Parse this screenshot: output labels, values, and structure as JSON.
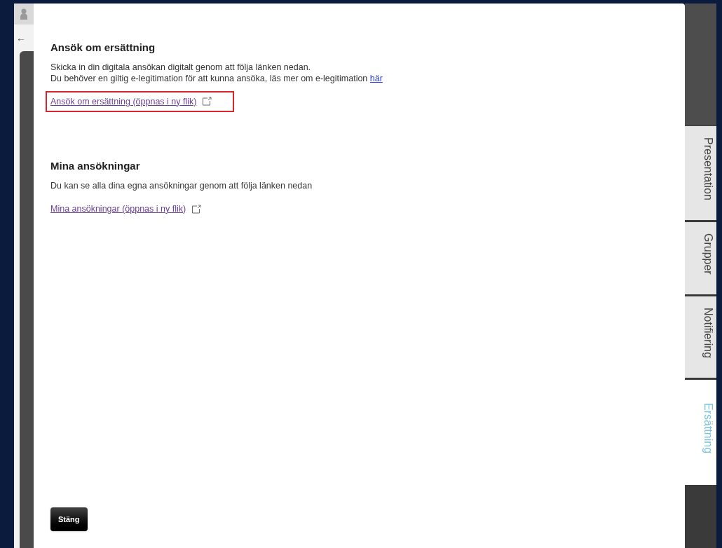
{
  "sidebar": {
    "back_arrow": "←"
  },
  "sections": [
    {
      "title": "Ansök om ersättning",
      "lines": [
        "Skicka in din digitala ansökan digitalt genom att följa länken nedan.",
        "Du behöver en giltig e-legitimation för att kunna ansöka, läs mer om e-legitimation"
      ],
      "inline_link": "här",
      "link": {
        "label": "Ansök om ersättning (öppnas i ny flik)",
        "highlighted": true
      }
    },
    {
      "title": "Mina ansökningar",
      "lines": [
        "Du kan se alla dina egna ansökningar genom att följa länken nedan"
      ],
      "link": {
        "label": "Mina ansökningar (öppnas i ny flik)",
        "highlighted": false
      }
    }
  ],
  "close_button": "Stäng",
  "tabs": [
    {
      "label": "Presentation",
      "selected": false
    },
    {
      "label": "Grupper",
      "selected": false
    },
    {
      "label": "Notifiering",
      "selected": false
    },
    {
      "label": "Ersättning",
      "selected": true
    }
  ]
}
